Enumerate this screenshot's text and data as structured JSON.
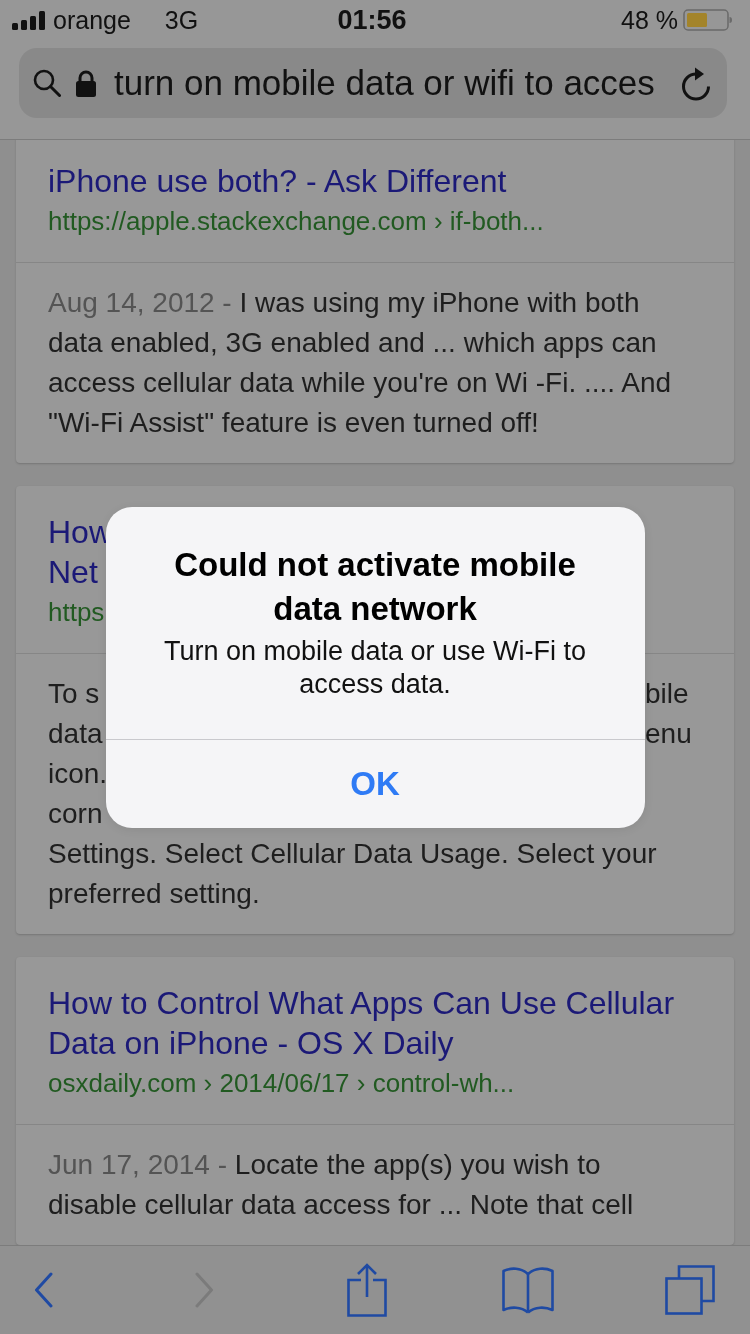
{
  "status_bar": {
    "carrier": "orange",
    "network": "3G",
    "time": "01:56",
    "battery": "48 %"
  },
  "address_bar": {
    "value": "turn on mobile data or wifi to acces"
  },
  "results": [
    {
      "kind": "full",
      "title": "iPhone use both? - Ask Different",
      "url": "https://apple.stackexchange.com › if-both...",
      "date": "Aug 14, 2012 -",
      "snippet": "I was using my iPhone with both data enabled, 3G enabled and ... which apps can access cellular data while you're on Wi -Fi. .... And \"Wi-Fi Assist\" feature is even turned off!"
    },
    {
      "kind": "partly_covered",
      "title_lines": [
        "How",
        "Net"
      ],
      "url_lines": [
        "https"
      ],
      "snippet_lines": [
        {
          "left": "To s",
          "right": "bile"
        },
        {
          "left": "data",
          "right": "enu"
        },
        {
          "left": "icon."
        },
        {
          "left": "corn"
        },
        {
          "left": "Settings. Select Cellular Data Usage. Select your"
        },
        {
          "left": "preferred setting."
        }
      ]
    },
    {
      "kind": "full",
      "title": "How to Control What Apps Can Use Cellular Data on iPhone - OS X Daily",
      "url": "osxdaily.com › 2014/06/17 › control-wh...",
      "date": "Jun 17, 2014 -",
      "snippet": "Locate the app(s) you wish to disable cellular data access for ... Note that cell"
    }
  ],
  "alert": {
    "title": "Could not activate mobile data network",
    "message": "Turn on mobile data or use Wi-Fi to access data.",
    "buttons": [
      "OK"
    ]
  },
  "toolbar": {
    "buttons": [
      {
        "kind": "back",
        "disabled": false
      },
      {
        "kind": "forward",
        "disabled": true
      },
      {
        "kind": "share",
        "disabled": false
      },
      {
        "kind": "bookmarks",
        "disabled": false
      },
      {
        "kind": "tabs",
        "disabled": false
      }
    ]
  }
}
